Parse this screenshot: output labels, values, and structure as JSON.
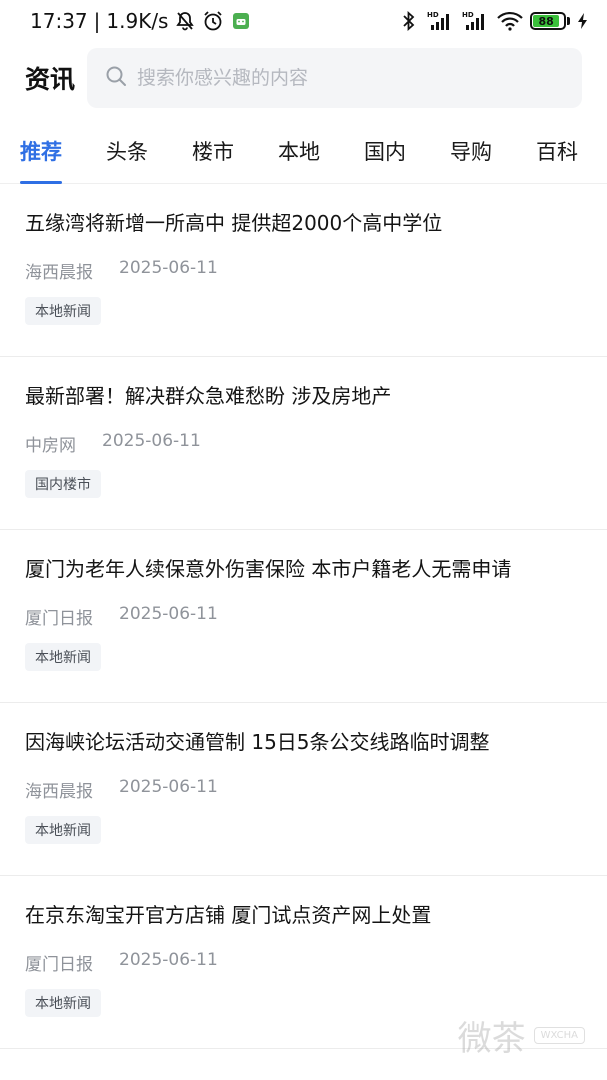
{
  "status_bar": {
    "time": "17:37",
    "separator": "|",
    "network_speed": "1.9K/s",
    "battery_level": "88",
    "icons": [
      "mute-bell-icon",
      "alarm-icon",
      "android-app-icon",
      "bluetooth-icon",
      "signal-hd-icon",
      "signal-hd-icon",
      "wifi-icon",
      "battery-icon",
      "charging-icon"
    ],
    "signal_badge": "HD"
  },
  "header": {
    "title": "资讯",
    "search_placeholder": "搜索你感兴趣的内容"
  },
  "tabs": [
    {
      "label": "推荐",
      "active": true
    },
    {
      "label": "头条",
      "active": false
    },
    {
      "label": "楼市",
      "active": false
    },
    {
      "label": "本地",
      "active": false
    },
    {
      "label": "国内",
      "active": false
    },
    {
      "label": "导购",
      "active": false
    },
    {
      "label": "百科",
      "active": false
    }
  ],
  "news": [
    {
      "title": "五缘湾将新增一所高中 提供超2000个高中学位",
      "source": "海西晨报",
      "date": "2025-06-11",
      "tag": "本地新闻"
    },
    {
      "title": "最新部署！解决群众急难愁盼 涉及房地产",
      "source": "中房网",
      "date": "2025-06-11",
      "tag": "国内楼市"
    },
    {
      "title": "厦门为老年人续保意外伤害保险 本市户籍老人无需申请",
      "source": "厦门日报",
      "date": "2025-06-11",
      "tag": "本地新闻"
    },
    {
      "title": "因海峡论坛活动交通管制 15日5条公交线路临时调整",
      "source": "海西晨报",
      "date": "2025-06-11",
      "tag": "本地新闻"
    },
    {
      "title": "在京东淘宝开官方店铺 厦门试点资产网上处置",
      "source": "厦门日报",
      "date": "2025-06-11",
      "tag": "本地新闻"
    }
  ],
  "watermark": {
    "text": "微茶",
    "badge": "WXCHA"
  },
  "colors": {
    "accent": "#2f6fe4",
    "battery_green": "#3ac03a",
    "meta_gray": "#8f939a"
  }
}
